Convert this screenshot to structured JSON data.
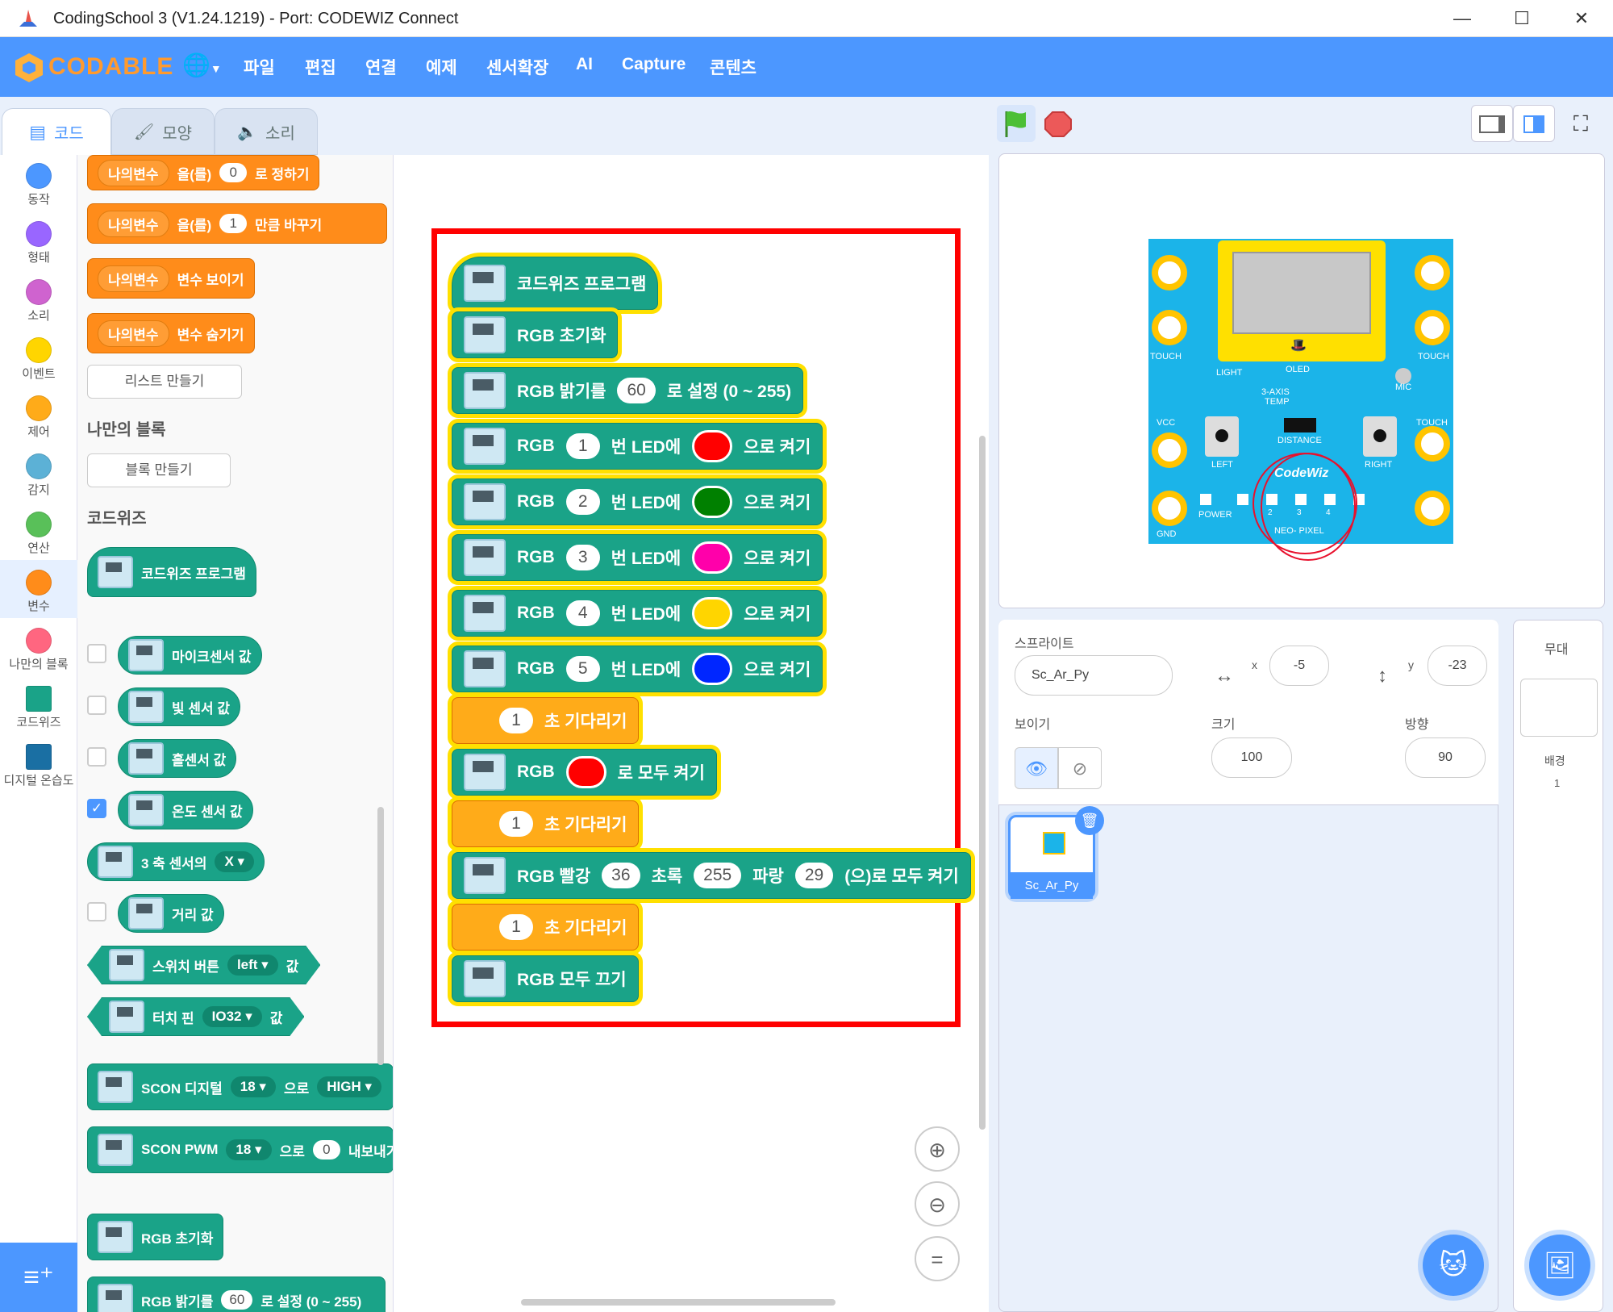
{
  "window": {
    "title": "CodingSchool 3 (V1.24.1219) - Port: CODEWIZ Connect",
    "controls": [
      "—",
      "☐",
      "✕"
    ]
  },
  "menubar": {
    "logo_text": "CODABLE",
    "items": [
      "파일",
      "편집",
      "연결",
      "예제",
      "센서확장",
      "AI",
      "Capture",
      "콘텐츠"
    ]
  },
  "tabs": [
    "코드",
    "모양",
    "소리"
  ],
  "categories": [
    {
      "label": "동작",
      "color": "#4c97ff"
    },
    {
      "label": "형태",
      "color": "#9966ff"
    },
    {
      "label": "소리",
      "color": "#cf63cf"
    },
    {
      "label": "이벤트",
      "color": "#ffd500"
    },
    {
      "label": "제어",
      "color": "#ffab19"
    },
    {
      "label": "감지",
      "color": "#5cb1d6"
    },
    {
      "label": "연산",
      "color": "#59c059"
    },
    {
      "label": "변수",
      "color": "#ff8c1a"
    },
    {
      "label": "나만의 블록",
      "color": "#ff6680"
    },
    {
      "label": "코드위즈",
      "color": "#1aa388"
    },
    {
      "label": "디지털 온습도",
      "color": "#1a6fa3"
    }
  ],
  "palette": {
    "var_name": "나의변수",
    "set_to": "을(를)",
    "set_suffix": "로 정하기",
    "set_value": "0",
    "change_by": "을(를)",
    "change_value": "1",
    "change_suffix": "만큼 바꾸기",
    "show_var": "변수 보이기",
    "hide_var": "변수 숨기기",
    "make_list": "리스트 만들기",
    "my_blocks_header": "나만의 블록",
    "make_block": "블록 만들기",
    "codewiz_header": "코드위즈",
    "codewiz_program": "코드위즈 프로그램",
    "mic_sensor": "마이크센서 값",
    "light_sensor": "빛 센서 값",
    "hall_sensor": "홀센서 값",
    "temp_sensor": "온도 센서 값",
    "axis_sensor": "3 축 센서의",
    "axis_value": "X",
    "distance": "거리 값",
    "switch_btn": "스위치 버튼",
    "switch_value": "left",
    "value_suffix": "값",
    "touch_pin": "터치 핀",
    "touch_value": "IO32",
    "scon_digital": "SCON 디지털",
    "scon_pin": "18",
    "scon_to": "으로",
    "scon_high": "HIGH",
    "scon_pwm": "SCON PWM",
    "pwm_value": "0",
    "pwm_suffix": "내보내기",
    "rgb_init": "RGB 초기화",
    "rgb_bright": "RGB 밝기를",
    "rgb_bright_value": "60",
    "rgb_bright_suffix": "로 설정 (0 ~ 255)"
  },
  "script": {
    "hat": "코드위즈 프로그램",
    "init": "RGB 초기화",
    "bright_label": "RGB 밝기를",
    "bright_value": "60",
    "bright_suffix": "로 설정 (0 ~ 255)",
    "led_rows": [
      {
        "prefix": "RGB",
        "n": "1",
        "mid": "번 LED에",
        "color": "#ff0000",
        "suffix": "으로 켜기"
      },
      {
        "prefix": "RGB",
        "n": "2",
        "mid": "번 LED에",
        "color": "#008000",
        "suffix": "으로 켜기"
      },
      {
        "prefix": "RGB",
        "n": "3",
        "mid": "번 LED에",
        "color": "#ff00aa",
        "suffix": "으로 켜기"
      },
      {
        "prefix": "RGB",
        "n": "4",
        "mid": "번 LED에",
        "color": "#ffd500",
        "suffix": "으로 켜기"
      },
      {
        "prefix": "RGB",
        "n": "5",
        "mid": "번 LED에",
        "color": "#0026ff",
        "suffix": "으로 켜기"
      }
    ],
    "wait_value": "1",
    "wait_label": "초 기다리기",
    "all_on_label": "RGB",
    "all_on_color": "#ff0000",
    "all_on_suffix": "로 모두 켜기",
    "rgb_mix": {
      "red_label": "RGB 빨강",
      "red": "36",
      "green_label": "초록",
      "green": "255",
      "blue_label": "파랑",
      "blue": "29",
      "suffix": "(으)로 모두 켜기"
    },
    "all_off": "RGB 모두 끄기"
  },
  "board": {
    "labels": {
      "oled": "OLED",
      "touch_left": "TOUCH",
      "touch_right": "TOUCH",
      "touch_right2": "TOUCH",
      "light": "LIGHT",
      "mic": "MIC",
      "axis": "3-AXIS",
      "temp": "TEMP",
      "vcc": "VCC",
      "distance": "DISTANCE",
      "left": "LEFT",
      "right": "RIGHT",
      "brand": "CodeWiz",
      "power": "POWER",
      "gnd": "GND",
      "neo": "NEO- PIXEL",
      "led_nums": [
        "2",
        "3",
        "4"
      ]
    }
  },
  "sprite": {
    "label": "스프라이트",
    "name": "Sc_Ar_Py",
    "x_label": "x",
    "x": "-5",
    "y_label": "y",
    "y": "-23",
    "show_label": "보이기",
    "size_label": "크기",
    "size": "100",
    "dir_label": "방향",
    "direction": "90",
    "thumb_name": "Sc_Ar_Py"
  },
  "stage_panel": {
    "title": "무대",
    "bg_label": "배경",
    "bg_count": "1"
  },
  "colors": {
    "accent": "#4c97ff",
    "codewiz": "#1aa388",
    "control": "#ffab19",
    "variables": "#ff8c1a",
    "highlight": "#ffe000",
    "frame": "#ff0000"
  }
}
